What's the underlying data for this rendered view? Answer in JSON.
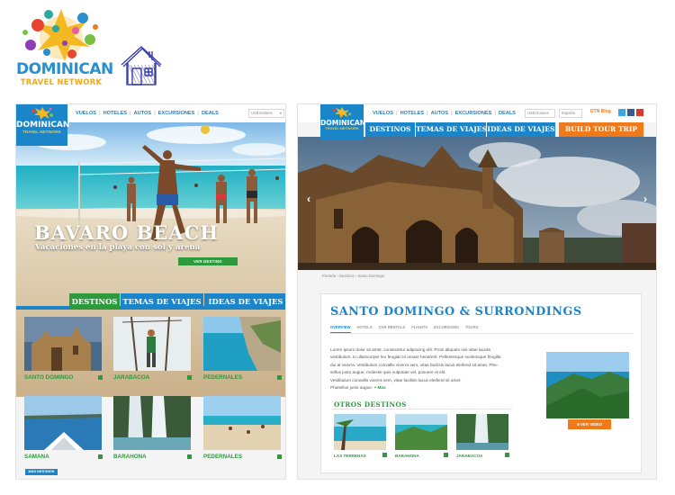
{
  "logo": {
    "brand_main": "DOMINICAN",
    "brand_sub": "TRAVEL NETWORK"
  },
  "left_page": {
    "logo_main": "DOMINICAN",
    "logo_sub": "TRAVEL NETWORK",
    "nav": [
      "VUELOS",
      "HOTELES",
      "AUTOS",
      "EXCURSIONES",
      "DEALS"
    ],
    "currency": "US$ Dolares",
    "hero_title": "BAVARO BEACH",
    "hero_subtitle": "Vacaciones en la playa con sol y arena",
    "hero_button": "VER DESTINO",
    "tabs": [
      "DESTINOS",
      "TEMAS DE VIAJES",
      "IDEAS DE VIAJES"
    ],
    "destinations": [
      "SANTO DOMINGO",
      "JARABACOA",
      "PEDERNALES",
      "SAMANA",
      "BARAHONA",
      "PEDERNALES"
    ],
    "more_button": "MÁS DESTINOS"
  },
  "right_page": {
    "logo_main": "DOMINICAN",
    "logo_sub": "TRAVEL NETWORK",
    "nav": [
      "VUELOS",
      "HOTELES",
      "AUTOS",
      "EXCURSIONES",
      "DEALS"
    ],
    "currency": "US$ Dolares",
    "language": "Español",
    "blog": "DTN Blog",
    "tabs": [
      "DESTINOS",
      "TEMAS DE VIAJES",
      "IDEAS DE VIAJES",
      "BUILD TOUR TRIP"
    ],
    "breadcrumb": [
      "Portada",
      "Destinos",
      "Santo Domingo"
    ],
    "page_title": "SANTO DOMINGO & SURRONDINGS",
    "subtabs": [
      "OVERVIEW",
      "HOTELS",
      "CAR RENTALS",
      "FLIGHTS",
      "EXCURSIONS",
      "TOURS"
    ],
    "body_lines": [
      "Lorem ipsum dolor sit amet, consectetur adipiscing elit. Proin aliquam nisi vitae iaculis",
      "vestibulum. In ullamcorper leo feugiat mi ornare hendrerit. Pellentesque scelerisque fringilla",
      "dui at viverra. Vestibulum convallis viverra sem, vitae facilisis lacus eleifend sit amet. Phe-",
      "sellus justo augue, molestie quis vulputate vel, posuere ut elit.",
      "Vestibulum convallis viverra sem, vitae facilisis lacus eleifend sit amet.",
      "Phasellus justo augue."
    ],
    "more_link": "+ Más",
    "otros_title": "OTROS DESTINOS",
    "otros": [
      "LAS TERRENAS",
      "BARAHONA",
      "JARABACOA"
    ],
    "video_button": "VER VIDEO"
  },
  "colors": {
    "blue": "#1a86c9",
    "green": "#2e9a3e",
    "orange": "#f07a1a"
  }
}
